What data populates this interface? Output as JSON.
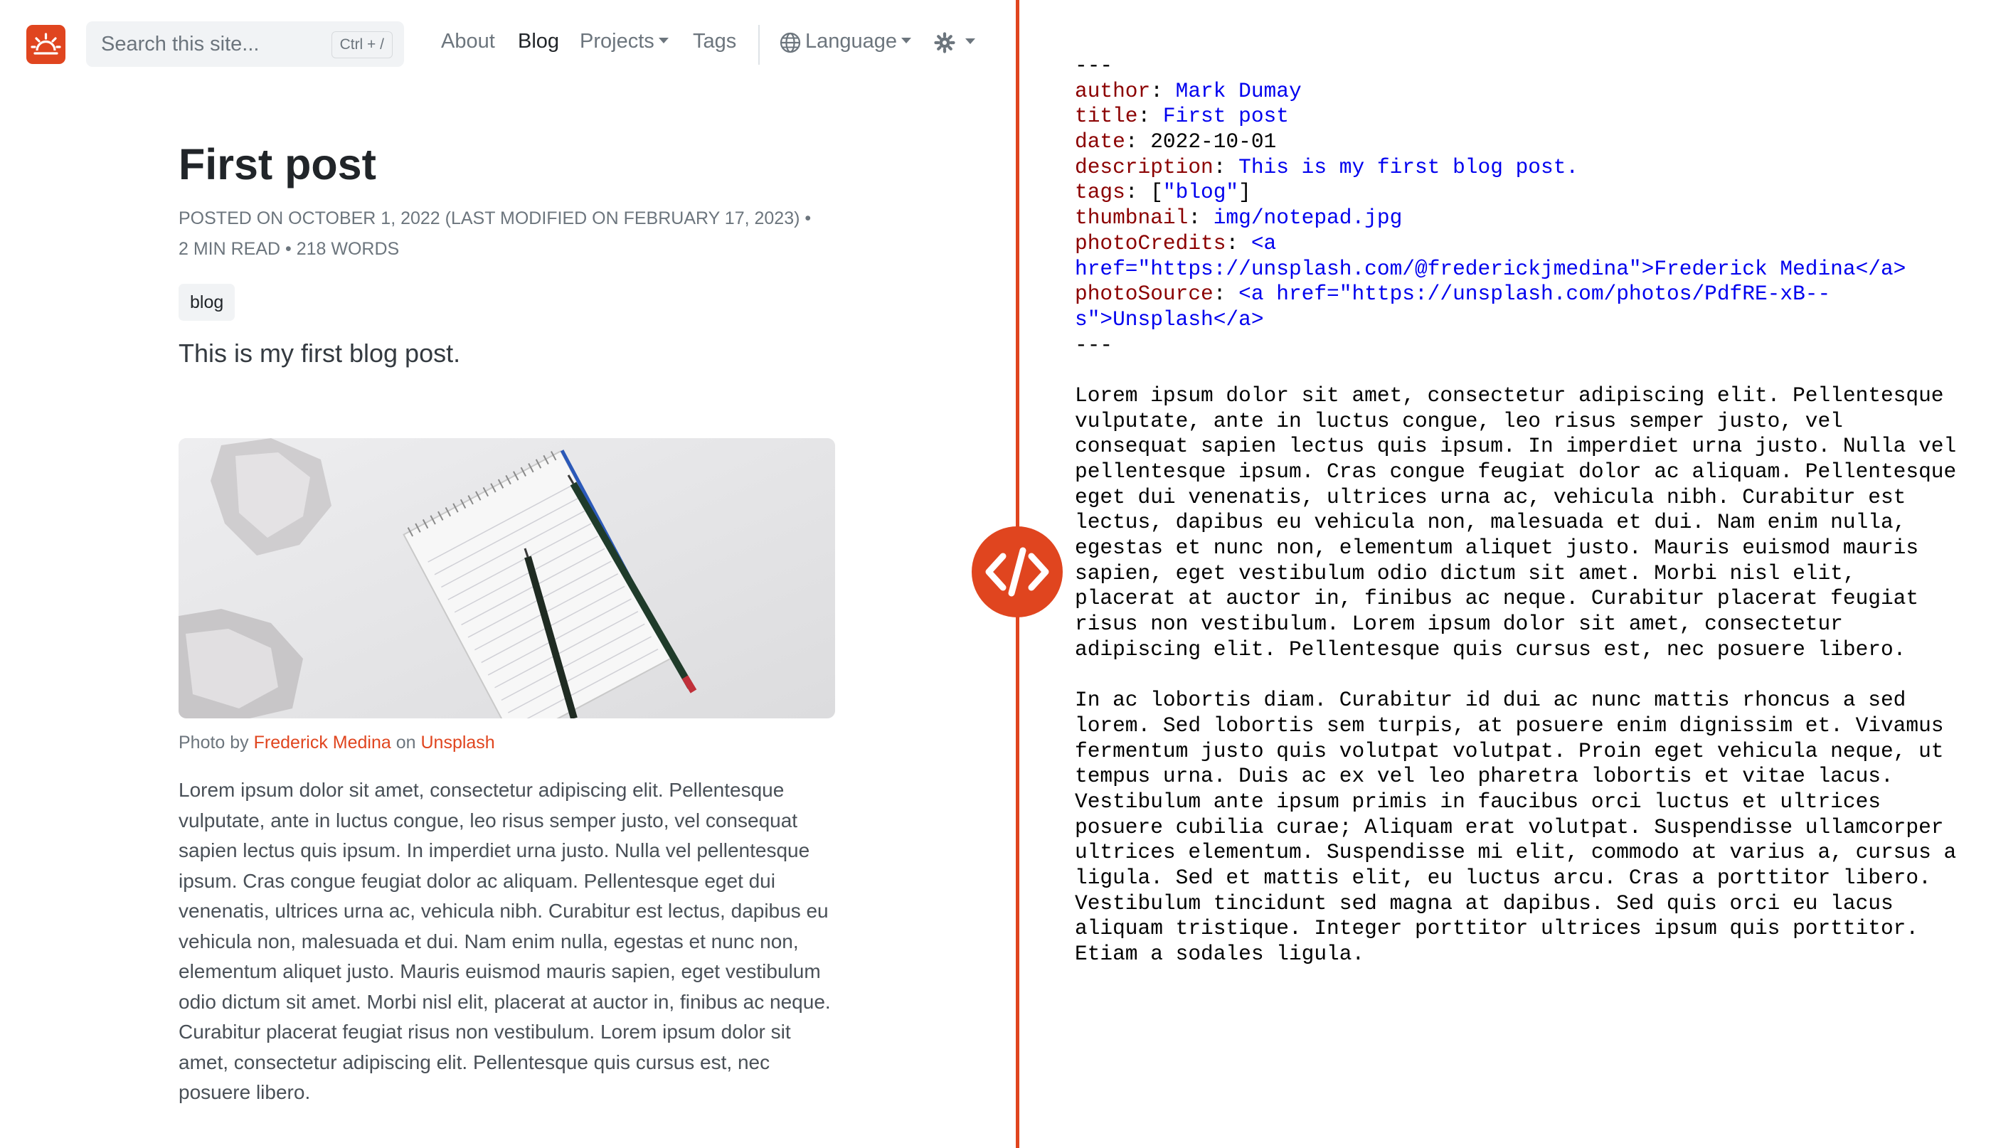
{
  "colors": {
    "accent": "#e0451f",
    "yaml_key": "#8b0000",
    "yaml_value": "#0000ee"
  },
  "navbar": {
    "logo_icon": "sunrise-icon",
    "search_placeholder": "Search this site...",
    "search_shortcut": "Ctrl + /",
    "links": {
      "about": "About",
      "blog": "Blog",
      "projects": "Projects",
      "tags": "Tags"
    },
    "language_label": "Language",
    "theme_icon": "gear-icon"
  },
  "post": {
    "title": "First post",
    "meta_line1": "POSTED ON OCTOBER 1, 2022 (LAST MODIFIED ON FEBRUARY 17, 2023) •",
    "meta_line2": "2 MIN READ • 218 WORDS",
    "tag": "blog",
    "lead": "This is my first blog post.",
    "caption": {
      "prefix": "Photo by ",
      "author": "Frederick Medina",
      "middle": " on ",
      "source": "Unsplash"
    },
    "body": "Lorem ipsum dolor sit amet, consectetur adipiscing elit. Pellentesque vulputate, ante in luctus congue, leo risus semper justo, vel consequat sapien lectus quis ipsum. In imperdiet urna justo. Nulla vel pellentesque ipsum. Cras congue feugiat dolor ac aliquam. Pellentesque eget dui venenatis, ultrices urna ac, vehicula nibh. Curabitur est lectus, dapibus eu vehicula non, malesuada et dui. Nam enim nulla, egestas et nunc non, elementum aliquet justo. Mauris euismod mauris sapien, eget vestibulum odio dictum sit amet. Morbi nisl elit, placerat at auctor in, finibus ac neque. Curabitur placerat feugiat risus non vestibulum. Lorem ipsum dolor sit amet, consectetur adipiscing elit. Pellentesque quis cursus est, nec posuere libero."
  },
  "code_badge_icon": "code-icon",
  "source": {
    "lines": [
      {
        "parts": [
          {
            "t": "---",
            "c": "p"
          }
        ]
      },
      {
        "parts": [
          {
            "t": "author",
            "c": "k"
          },
          {
            "t": ": ",
            "c": "p"
          },
          {
            "t": "Mark Dumay",
            "c": "s"
          }
        ]
      },
      {
        "parts": [
          {
            "t": "title",
            "c": "k"
          },
          {
            "t": ": ",
            "c": "p"
          },
          {
            "t": "First post",
            "c": "s"
          }
        ]
      },
      {
        "parts": [
          {
            "t": "date",
            "c": "k"
          },
          {
            "t": ": 2022-10-01",
            "c": "p"
          }
        ]
      },
      {
        "parts": [
          {
            "t": "description",
            "c": "k"
          },
          {
            "t": ": ",
            "c": "p"
          },
          {
            "t": "This is my first blog post.",
            "c": "s"
          }
        ]
      },
      {
        "parts": [
          {
            "t": "tags",
            "c": "k"
          },
          {
            "t": ": [",
            "c": "p"
          },
          {
            "t": "\"blog\"",
            "c": "s"
          },
          {
            "t": "]",
            "c": "p"
          }
        ]
      },
      {
        "parts": [
          {
            "t": "thumbnail",
            "c": "k"
          },
          {
            "t": ": ",
            "c": "p"
          },
          {
            "t": "img/notepad.jpg",
            "c": "s"
          }
        ]
      },
      {
        "parts": [
          {
            "t": "photoCredits",
            "c": "k"
          },
          {
            "t": ": ",
            "c": "p"
          },
          {
            "t": "<a",
            "c": "s"
          }
        ]
      },
      {
        "parts": [
          {
            "t": "href=\"https://unsplash.com/@frederickjmedina\">Frederick Medina</a>",
            "c": "s"
          }
        ]
      },
      {
        "parts": [
          {
            "t": "photoSource",
            "c": "k"
          },
          {
            "t": ": ",
            "c": "p"
          },
          {
            "t": "<a href=\"https://unsplash.com/photos/PdfRE-xB--",
            "c": "s"
          }
        ]
      },
      {
        "parts": [
          {
            "t": "s\">Unsplash</a>",
            "c": "s"
          }
        ]
      },
      {
        "parts": [
          {
            "t": "---",
            "c": "p"
          }
        ]
      },
      {
        "parts": [
          {
            "t": "",
            "c": "p"
          }
        ]
      },
      {
        "parts": [
          {
            "t": "Lorem ipsum dolor sit amet, consectetur adipiscing elit. Pellentesque",
            "c": "p"
          }
        ]
      },
      {
        "parts": [
          {
            "t": "vulputate, ante in luctus congue, leo risus semper justo, vel",
            "c": "p"
          }
        ]
      },
      {
        "parts": [
          {
            "t": "consequat sapien lectus quis ipsum. In imperdiet urna justo. Nulla vel",
            "c": "p"
          }
        ]
      },
      {
        "parts": [
          {
            "t": "pellentesque ipsum. Cras congue feugiat dolor ac aliquam. Pellentesque",
            "c": "p"
          }
        ]
      },
      {
        "parts": [
          {
            "t": "eget dui venenatis, ultrices urna ac, vehicula nibh. Curabitur est",
            "c": "p"
          }
        ]
      },
      {
        "parts": [
          {
            "t": "lectus, dapibus eu vehicula non, malesuada et dui. Nam enim nulla,",
            "c": "p"
          }
        ]
      },
      {
        "parts": [
          {
            "t": "egestas et nunc non, elementum aliquet justo. Mauris euismod mauris",
            "c": "p"
          }
        ]
      },
      {
        "parts": [
          {
            "t": "sapien, eget vestibulum odio dictum sit amet. Morbi nisl elit,",
            "c": "p"
          }
        ]
      },
      {
        "parts": [
          {
            "t": "placerat at auctor in, finibus ac neque. Curabitur placerat feugiat",
            "c": "p"
          }
        ]
      },
      {
        "parts": [
          {
            "t": "risus non vestibulum. Lorem ipsum dolor sit amet, consectetur",
            "c": "p"
          }
        ]
      },
      {
        "parts": [
          {
            "t": "adipiscing elit. Pellentesque quis cursus est, nec posuere libero.",
            "c": "p"
          }
        ]
      },
      {
        "parts": [
          {
            "t": "",
            "c": "p"
          }
        ]
      },
      {
        "parts": [
          {
            "t": "In ac lobortis diam. Curabitur id dui ac nunc mattis rhoncus a sed",
            "c": "p"
          }
        ]
      },
      {
        "parts": [
          {
            "t": "lorem. Sed lobortis sem turpis, at posuere enim dignissim et. Vivamus",
            "c": "p"
          }
        ]
      },
      {
        "parts": [
          {
            "t": "fermentum justo quis volutpat volutpat. Proin eget vehicula neque, ut",
            "c": "p"
          }
        ]
      },
      {
        "parts": [
          {
            "t": "tempus urna. Duis ac ex vel leo pharetra lobortis et vitae lacus.",
            "c": "p"
          }
        ]
      },
      {
        "parts": [
          {
            "t": "Vestibulum ante ipsum primis in faucibus orci luctus et ultrices",
            "c": "p"
          }
        ]
      },
      {
        "parts": [
          {
            "t": "posuere cubilia curae; Aliquam erat volutpat. Suspendisse ullamcorper",
            "c": "p"
          }
        ]
      },
      {
        "parts": [
          {
            "t": "ultrices elementum. Suspendisse mi elit, commodo at varius a, cursus a",
            "c": "p"
          }
        ]
      },
      {
        "parts": [
          {
            "t": "ligula. Sed et mattis elit, eu luctus arcu. Cras a porttitor libero.",
            "c": "p"
          }
        ]
      },
      {
        "parts": [
          {
            "t": "Vestibulum tincidunt sed magna at dapibus. Sed quis orci eu lacus",
            "c": "p"
          }
        ]
      },
      {
        "parts": [
          {
            "t": "aliquam tristique. Integer porttitor ultrices ipsum quis porttitor.",
            "c": "p"
          }
        ]
      },
      {
        "parts": [
          {
            "t": "Etiam a sodales ligula.",
            "c": "p"
          }
        ]
      }
    ]
  }
}
